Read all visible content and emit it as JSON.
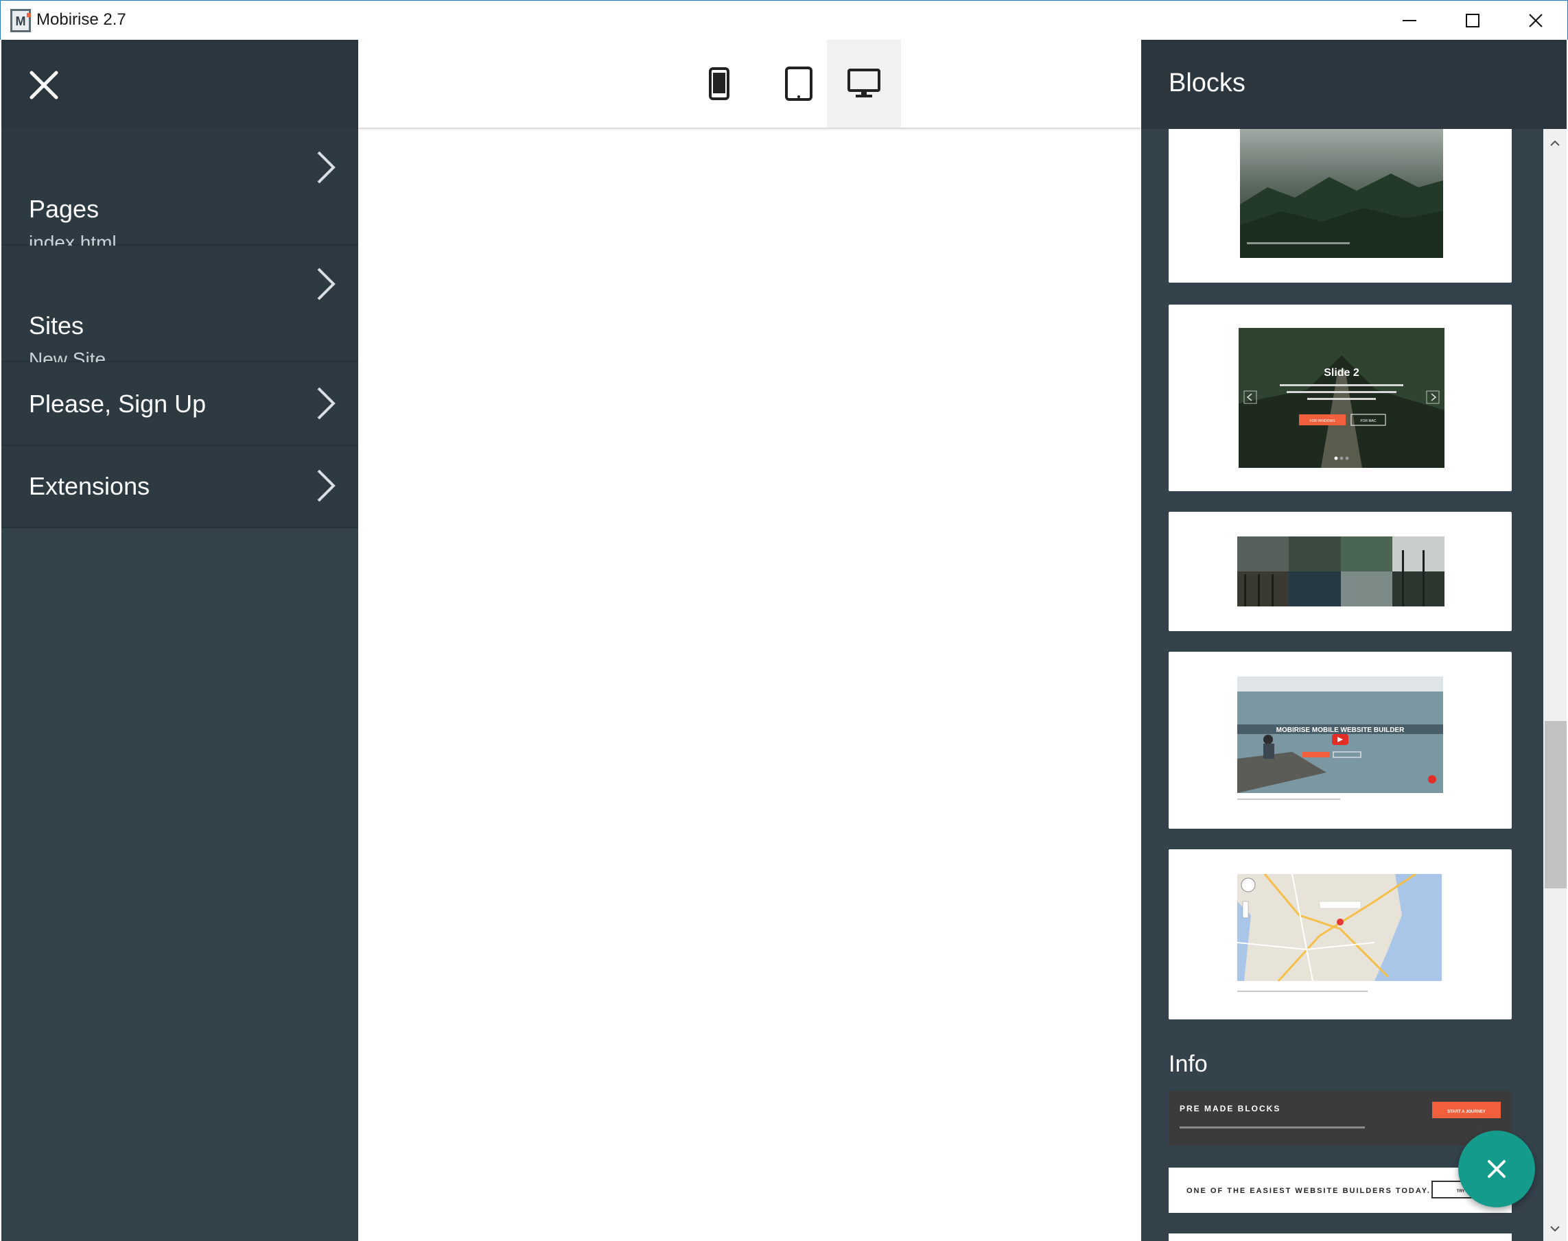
{
  "window": {
    "title": "Mobirise 2.7",
    "controls": [
      "minimize",
      "maximize",
      "close"
    ]
  },
  "sidebar": {
    "items": [
      {
        "label": "Pages",
        "sub": "index.html"
      },
      {
        "label": "Sites",
        "sub": "New Site"
      },
      {
        "label": "Please, Sign Up",
        "sub": ""
      },
      {
        "label": "Extensions",
        "sub": ""
      }
    ]
  },
  "devicebar": {
    "active": "desktop",
    "devices": [
      "phone",
      "tablet",
      "desktop"
    ]
  },
  "blocks_panel": {
    "title": "Blocks",
    "slider_card": {
      "slide_title": "Slide 2",
      "btn1": "FOR WINDOWS",
      "btn2": "FOR MAC"
    },
    "video_card": {
      "headline": "MOBIRISE MOBILE WEBSITE BUILDER"
    },
    "info_section_title": "Info",
    "info_cards": [
      {
        "headline": "PRE MADE BLOCKS",
        "button": "START A JOURNEY"
      },
      {
        "headline": "ONE OF THE EASIEST WEBSITE BUILDERS TODAY.",
        "button": "TRY IT"
      }
    ]
  },
  "colors": {
    "panel": "#34424c",
    "panel_header": "#2b363e",
    "accent_fab": "#149b8c",
    "cta_orange": "#f15f3c"
  }
}
